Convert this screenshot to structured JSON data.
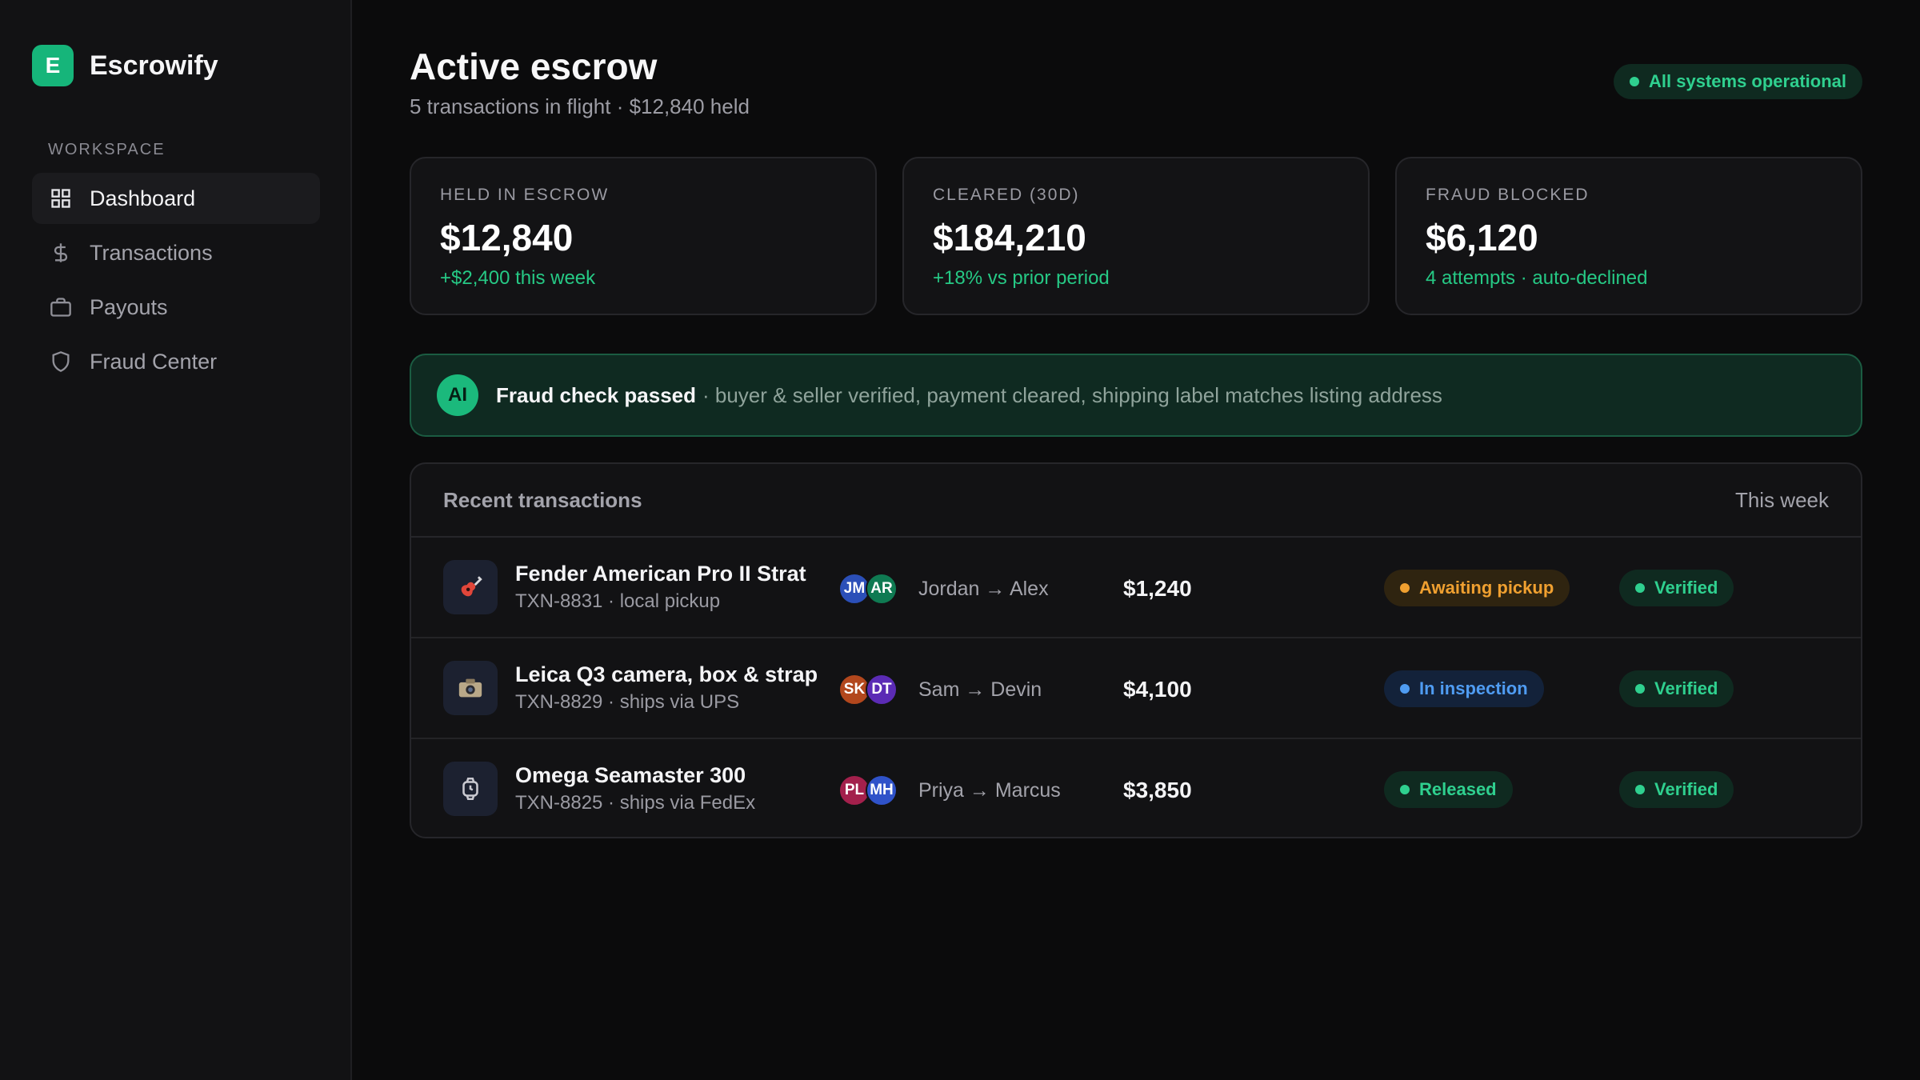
{
  "app": {
    "logo_letter": "E",
    "name": "Escrowify"
  },
  "sidebar": {
    "section_label": "WORKSPACE",
    "items": [
      {
        "label": "Dashboard",
        "icon": "grid-icon",
        "active": true
      },
      {
        "label": "Transactions",
        "icon": "dollar-icon",
        "active": false
      },
      {
        "label": "Payouts",
        "icon": "briefcase-icon",
        "active": false
      },
      {
        "label": "Fraud Center",
        "icon": "shield-icon",
        "active": false
      }
    ]
  },
  "header": {
    "title": "Active escrow",
    "subtitle": "5 transactions in flight · $12,840 held",
    "status": "All systems operational"
  },
  "stats": [
    {
      "label": "HELD IN ESCROW",
      "value": "$12,840",
      "note": "+$2,400 this week"
    },
    {
      "label": "CLEARED (30D)",
      "value": "$184,210",
      "note": "+18% vs prior period"
    },
    {
      "label": "FRAUD BLOCKED",
      "value": "$6,120",
      "note": "4 attempts · auto-declined"
    }
  ],
  "fraud_banner": {
    "badge": "AI",
    "title": "Fraud check passed",
    "detail": "· buyer & seller verified, payment cleared, shipping label matches listing address"
  },
  "transactions": {
    "title": "Recent transactions",
    "range": "This week",
    "rows": [
      {
        "icon": "guitar-icon",
        "name": "Fender American Pro II Strat",
        "meta": "TXN-8831 · local pickup",
        "buyer_initials": "JM",
        "seller_initials": "AR",
        "parties": "Jordan → Alex",
        "amount": "$1,240",
        "status": "Awaiting pickup",
        "verification": "Verified"
      },
      {
        "icon": "camera-icon",
        "name": "Leica Q3 camera, box & strap",
        "meta": "TXN-8829 · ships via UPS",
        "buyer_initials": "SK",
        "seller_initials": "DT",
        "parties": "Sam → Devin",
        "amount": "$4,100",
        "status": "In inspection",
        "verification": "Verified"
      },
      {
        "icon": "watch-icon",
        "name": "Omega Seamaster 300",
        "meta": "TXN-8825 · ships via FedEx",
        "buyer_initials": "PL",
        "seller_initials": "MH",
        "parties": "Priya → Marcus",
        "amount": "$3,850",
        "status": "Released",
        "verification": "Verified"
      }
    ]
  },
  "colors": {
    "accent": "#16b57a",
    "success_text": "#2fd08f",
    "warning_text": "#f0a030",
    "info_text": "#4f9cf2",
    "avatar_jm": "#2b4fb8",
    "avatar_ar": "#0f7a52",
    "avatar_sk": "#b2471d",
    "avatar_dt": "#5b2bb5",
    "avatar_pl": "#a3204c",
    "avatar_mh": "#2f52c9"
  }
}
